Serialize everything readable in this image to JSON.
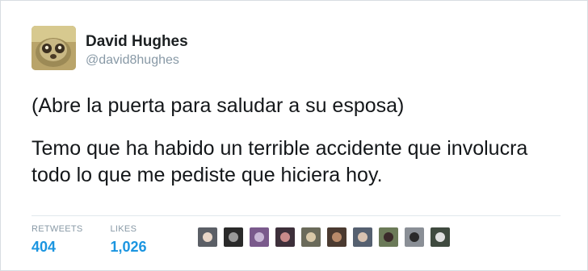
{
  "tweet": {
    "display_name": "David Hughes",
    "handle": "@david8hughes",
    "text_lines": [
      "(Abre la puerta para saludar a su esposa)",
      "Temo que ha habido un terrible accidente que involucra todo lo que me pediste que hiciera hoy."
    ],
    "stats": {
      "retweets_label": "RETWEETS",
      "retweets_value": "404",
      "likes_label": "LIKES",
      "likes_value": "1,026"
    }
  },
  "colors": {
    "link_blue": "#1b95e0",
    "meta_gray": "#8899a6",
    "divider": "#e1e8ed"
  },
  "icons": {
    "avatar": "sloth-photo-avatar",
    "liker_avatars": "user-avatar-thumbnails"
  }
}
